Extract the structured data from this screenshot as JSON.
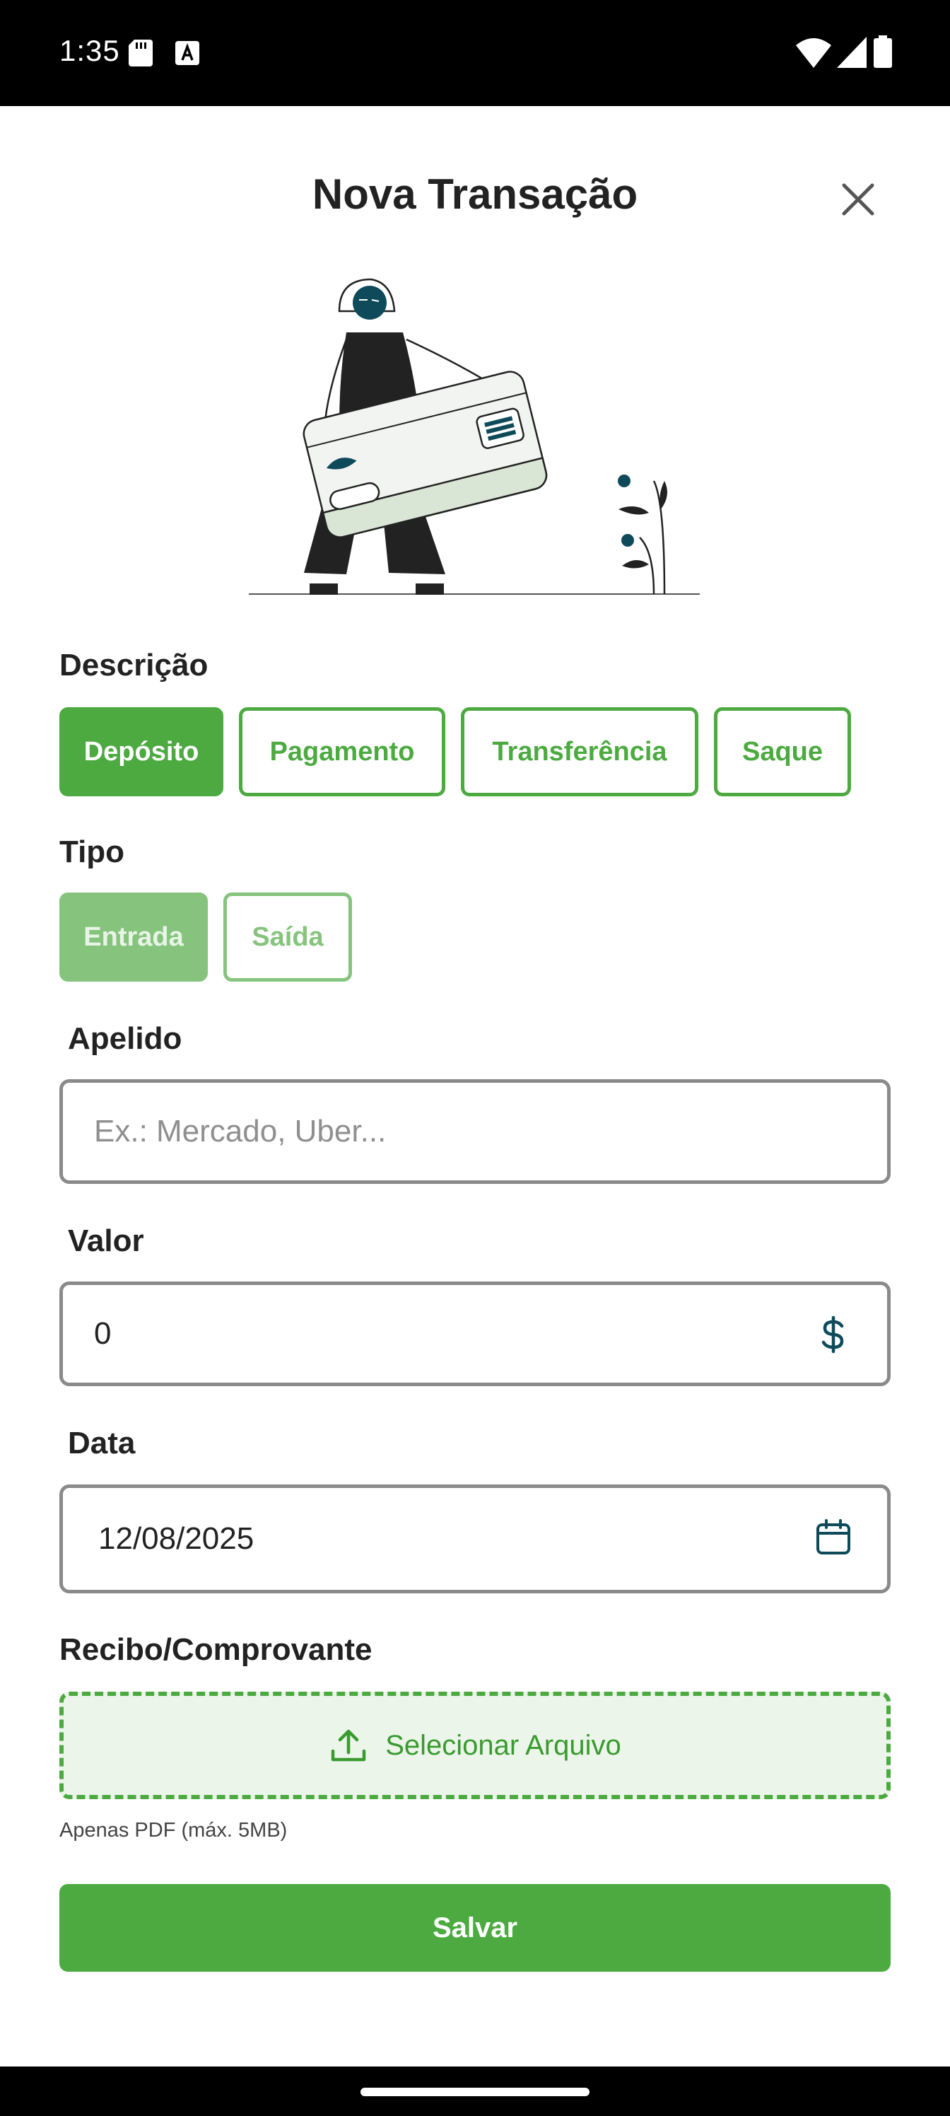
{
  "status_bar": {
    "time": "1:35"
  },
  "header": {
    "title": "Nova Transação"
  },
  "descricao": {
    "label": "Descrição",
    "options": [
      "Depósito",
      "Pagamento",
      "Transferência",
      "Saque"
    ],
    "selected": "Depósito"
  },
  "tipo": {
    "label": "Tipo",
    "options": [
      "Entrada",
      "Saída"
    ],
    "selected": "Entrada",
    "disabled": true
  },
  "apelido": {
    "label": "Apelido",
    "value": "",
    "placeholder": "Ex.: Mercado, Uber..."
  },
  "valor": {
    "label": "Valor",
    "value": "0",
    "icon": "dollar-icon"
  },
  "data": {
    "label": "Data",
    "value": "12/08/2025",
    "icon": "calendar-icon"
  },
  "recibo": {
    "label": "Recibo/Comprovante",
    "upload_label": "Selecionar Arquivo",
    "hint": "Apenas PDF (máx. 5MB)",
    "icon": "upload-icon"
  },
  "actions": {
    "save_label": "Salvar"
  },
  "colors": {
    "accent": "#4caa41",
    "accent_disabled": "#86c47e",
    "upload_bg": "#ebf5e9",
    "icon_teal": "#0e4a5a"
  }
}
